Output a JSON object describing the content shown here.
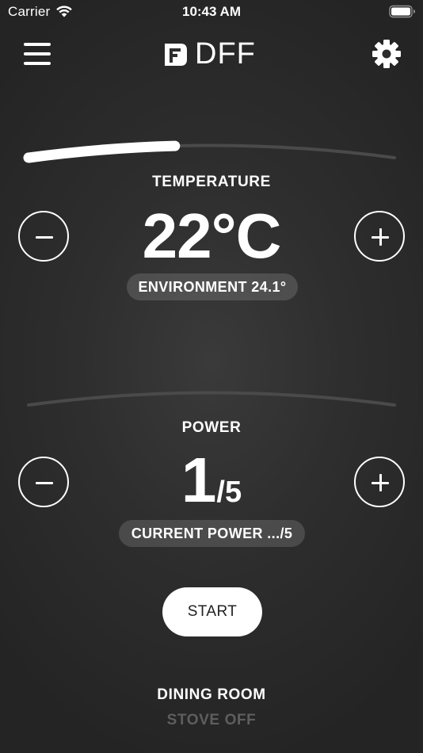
{
  "status_bar": {
    "carrier": "Carrier",
    "time": "10:43 AM",
    "icons": [
      "wifi-icon",
      "battery-icon"
    ]
  },
  "header": {
    "logo_text": "DFF",
    "menu_icon": "hamburger-menu-icon",
    "settings_icon": "gear-icon"
  },
  "temperature": {
    "label": "TEMPERATURE",
    "value": "22°C",
    "environment": "ENVIRONMENT 24.1°",
    "slider_fraction": 0.4
  },
  "power": {
    "label": "POWER",
    "value": "1",
    "max": "/5",
    "current": "CURRENT POWER .../5",
    "slider_fraction": 0
  },
  "controls": {
    "start_label": "START"
  },
  "footer": {
    "room": "DINING ROOM",
    "status": "STOVE OFF"
  },
  "colors": {
    "background": "#2e2e2e",
    "foreground": "#ffffff",
    "muted": "#5e5e5e",
    "track": "#4a4a4a"
  }
}
